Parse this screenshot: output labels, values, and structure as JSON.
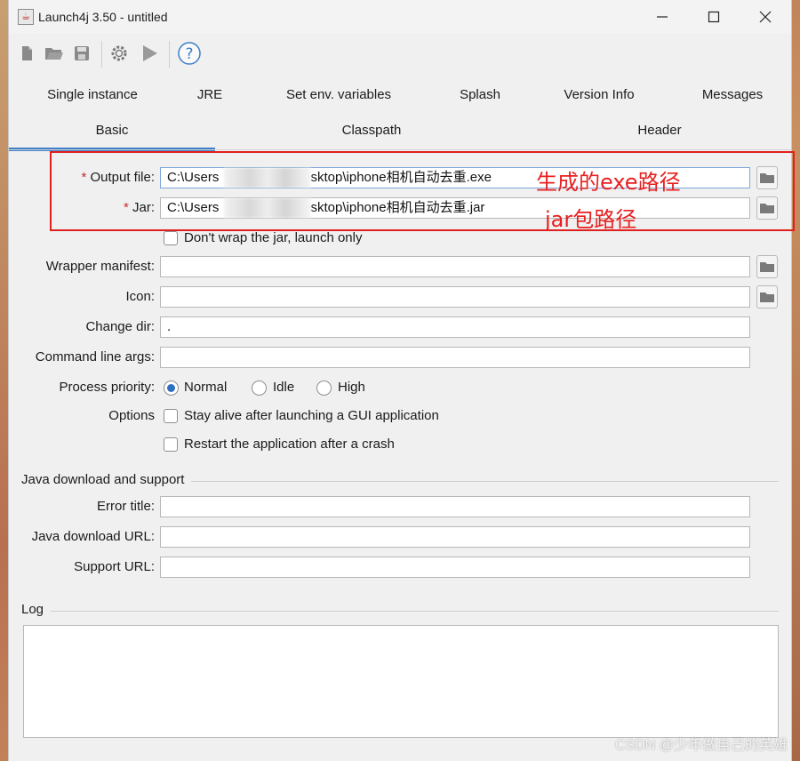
{
  "window": {
    "title": "Launch4j 3.50 - untitled"
  },
  "tabs": {
    "row1": [
      "Single instance",
      "JRE",
      "Set env. variables",
      "Splash",
      "Version Info",
      "Messages"
    ],
    "row2": [
      "Basic",
      "Classpath",
      "Header"
    ],
    "active": "Basic"
  },
  "form": {
    "output_file": {
      "label": "Output file:",
      "required": "*",
      "value": "C:\\Users\\        Desktop\\iphone相机自动去重.exe",
      "value_prefix": "C:\\Users",
      "value_suffix": "Desktop\\iphone相机自动去重.exe"
    },
    "jar": {
      "label": "Jar:",
      "required": "*",
      "value_prefix": "C:\\Users",
      "value_suffix": "Desktop\\iphone相机自动去重.jar"
    },
    "dont_wrap": {
      "label": "Don't wrap the jar, launch only",
      "checked": false
    },
    "wrapper_manifest": {
      "label": "Wrapper manifest:",
      "value": ""
    },
    "icon": {
      "label": "Icon:",
      "value": ""
    },
    "change_dir": {
      "label": "Change dir:",
      "value": "."
    },
    "cmd_args": {
      "label": "Command line args:",
      "value": ""
    },
    "priority": {
      "label": "Process priority:",
      "options": [
        "Normal",
        "Idle",
        "High"
      ],
      "selected": "Normal"
    },
    "options": {
      "label": "Options",
      "stay_alive": "Stay alive after launching a GUI application",
      "restart": "Restart the application after a crash"
    }
  },
  "java_download": {
    "section_title": "Java download and support",
    "error_title": {
      "label": "Error title:",
      "value": ""
    },
    "download_url": {
      "label": "Java download URL:",
      "value": ""
    },
    "support_url": {
      "label": "Support URL:",
      "value": ""
    }
  },
  "log": {
    "section_title": "Log",
    "content": ""
  },
  "annotations": {
    "exe_note": "生成的exe路径",
    "jar_note": "jar包路径",
    "color": "#e82020"
  },
  "watermark": "CSDN @少年做自己的英雄",
  "colors": {
    "accent": "#3c7fc8",
    "annotation_red": "#e02020",
    "window_bg": "#f0f0f0"
  }
}
